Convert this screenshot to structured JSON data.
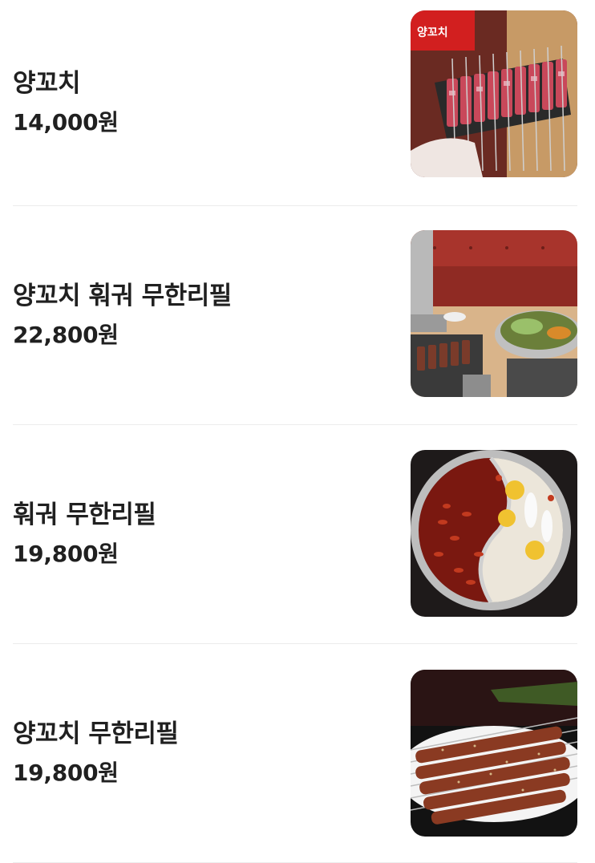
{
  "menu": {
    "items": [
      {
        "name": "양꼬치",
        "price": "14,000원",
        "image": "lamb-skewers-raw-photo",
        "sign_text": "양꼬치"
      },
      {
        "name": "양꼬치 훠궈 무한리필",
        "price": "22,800원",
        "image": "lamb-skewers-and-hotpot-table-photo"
      },
      {
        "name": "훠궈 무한리필",
        "price": "19,800원",
        "image": "split-hotpot-photo"
      },
      {
        "name": "양꼬치 무한리필",
        "price": "19,800원",
        "image": "grilled-lamb-skewers-plate-photo"
      }
    ]
  },
  "colors": {
    "text": "#202020",
    "divider": "#ececec"
  }
}
